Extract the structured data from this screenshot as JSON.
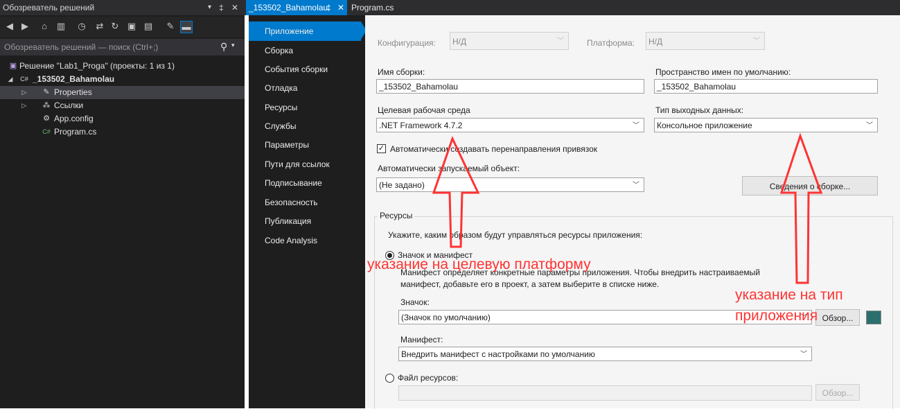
{
  "solution_explorer": {
    "title": "Обозреватель решений",
    "title_controls": [
      "▾",
      "‡",
      "✕"
    ],
    "search_placeholder": "Обозреватель решений — поиск (Ctrl+;)",
    "tree": [
      {
        "label": "Решение \"Lab1_Proga\" (проекты: 1 из 1)",
        "icon": "solution-icon"
      },
      {
        "label": "_153502_Bahamolau",
        "icon": "csharp-project-icon",
        "bold": true
      },
      {
        "label": "Properties",
        "icon": "wrench-icon",
        "selected": true
      },
      {
        "label": "Ссылки",
        "icon": "references-icon"
      },
      {
        "label": "App.config",
        "icon": "config-file-icon"
      },
      {
        "label": "Program.cs",
        "icon": "csharp-file-icon"
      }
    ]
  },
  "tabs": [
    {
      "label": "_153502_Bahamolau",
      "pin": "‡",
      "close": "✕",
      "active": true
    },
    {
      "label": "Program.cs",
      "active": false
    }
  ],
  "nav": {
    "items": [
      "Приложение",
      "Сборка",
      "События сборки",
      "Отладка",
      "Ресурсы",
      "Службы",
      "Параметры",
      "Пути для ссылок",
      "Подписывание",
      "Безопасность",
      "Публикация",
      "Code Analysis"
    ],
    "active": "Приложение"
  },
  "app": {
    "configuration_label": "Конфигурация:",
    "configuration_value": "Н/Д",
    "platform_label": "Платформа:",
    "platform_value": "Н/Д",
    "assembly_name_label": "Имя сборки:",
    "assembly_name_value": "_153502_Bahamolau",
    "default_namespace_label": "Пространство имен по умолчанию:",
    "default_namespace_value": "_153502_Bahamolau",
    "target_framework_label": "Целевая рабочая среда",
    "target_framework_value": ".NET Framework 4.7.2",
    "output_type_label": "Тип выходных данных:",
    "output_type_value": "Консольное приложение",
    "auto_redirects_label": "Автоматически создавать перенаправления привязок",
    "auto_redirects_checked": true,
    "startup_object_label": "Автоматически запускаемый объект:",
    "startup_object_value": "(Не задано)",
    "assembly_info_button": "Сведения о сборке..."
  },
  "resources": {
    "group_label": "Ресурсы",
    "description": "Укажите, каким образом будут управляться ресурсы приложения:",
    "icon_manifest_label": "Значок и манифест",
    "icon_manifest_desc_line1": "Манифест определяет конкретные параметры приложения. Чтобы внедрить настраиваемый",
    "icon_manifest_desc_line2": "манифест, добавьте его в проект, а затем выберите в списке ниже.",
    "icon_label": "Значок:",
    "icon_value": "(Значок по умолчанию)",
    "browse_label": "Обзор...",
    "manifest_label": "Манифест:",
    "manifest_value": "Внедрить манифест с настройками по умолчанию",
    "resource_file_label": "Файл ресурсов:",
    "resource_file_browse": "Обзор..."
  },
  "annotations": {
    "platform": "указание на целевую платформу",
    "app_type_line1": "указание на тип",
    "app_type_line2": "приложения"
  },
  "colors": {
    "accent": "#007acc",
    "annotation": "#ff3333",
    "dark_bg": "#1e1e1e"
  }
}
